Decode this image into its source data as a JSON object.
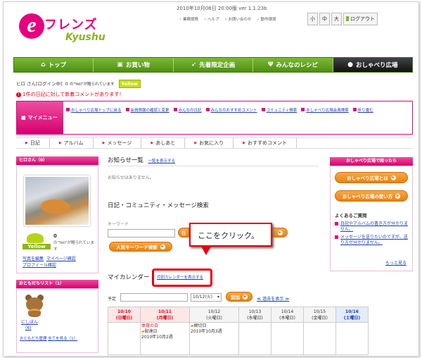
{
  "header": {
    "logo_text_jp": "フレンズ",
    "logo_text_en": "Kyushu",
    "version": "2010年10月08日 20:00版 ver 1.1.23b",
    "links": [
      "業務提携",
      "ヘルプ",
      "お問い合わせ",
      "動作環境"
    ],
    "size_buttons": [
      "小",
      "中",
      "大"
    ],
    "logout": "ログアウト"
  },
  "nav": {
    "items": [
      {
        "label": "トップ",
        "icon": "home-icon"
      },
      {
        "label": "お買い物",
        "icon": "shopping-icon"
      },
      {
        "label": "先着限定企画",
        "icon": "runner-icon"
      },
      {
        "label": "みんなのレシピ",
        "icon": "cutlery-icon"
      },
      {
        "label": "おしゃべり広場",
        "icon": "chat-icon"
      }
    ]
  },
  "user": {
    "name_line": "ヒロ さん[ログイン中]",
    "yell_count": "0",
    "yell_text": "の\"Yell\"が贈られています",
    "badge": "Yellow"
  },
  "notice": "1件の日記に対して新着コメントがあります！",
  "mymenu": {
    "label": "マイメニュー",
    "items": [
      "おしゃべり広場トップに戻る",
      "会員情報の確認と変更",
      "みんなの日記",
      "みんなのおすすめコメント",
      "コミュニティ検索",
      "おしゃべり広場会員検索",
      "折り畳む"
    ]
  },
  "subtabs": [
    "日記",
    "アルバム",
    "メッセージ",
    "あしあと",
    "お気に入り",
    "おすすめコメント"
  ],
  "left": {
    "profile_head": "ヒロさん（0）",
    "yell_num": "0",
    "yell_desc": "の\"Yell\"が贈られています",
    "badge": "Yellow",
    "links": [
      "写真を編集",
      "マイページ確認",
      "プロフィール確認"
    ],
    "friends_head": "おともだちリスト（1）",
    "friend_name": "にしぽん",
    "friend_count": "(6)",
    "friend_links": [
      "おともだち管理",
      "全てを見る（1）"
    ]
  },
  "center": {
    "notice_title": "お知らせ一覧",
    "notice_link": "一覧を表示する",
    "notice_empty": "お知らせはありません。",
    "search_title": "日記・コミュニティ・メッセージ検索",
    "keyword_label": "キーワード",
    "popular_btn": "人気キーワード検索",
    "callout": "ここをクリック。",
    "calendar_title": "マイカレンダー",
    "calendar_link": "月別カレンダーを表示する",
    "plan_label": "予定",
    "date_select": "10/12(火)",
    "add_btn": "追加",
    "prev_link": "≪ 過去を表示 ≫",
    "days": [
      {
        "date": "10/10",
        "dow": "(日曜日)",
        "color": "#e60012"
      },
      {
        "date": "10/11",
        "dow": "(月曜日)",
        "color": "#e60012"
      },
      {
        "date": "10/12",
        "dow": "(火曜日)",
        "color": "#333333"
      },
      {
        "date": "10/13",
        "dow": "(水曜日)",
        "color": "#333333"
      },
      {
        "date": "10/14",
        "dow": "(木曜日)",
        "color": "#333333"
      },
      {
        "date": "10/15",
        "dow": "(金曜日)",
        "color": "#333333"
      },
      {
        "date": "10/16",
        "dow": "(土曜日)",
        "color": "#1a3fb3"
      }
    ],
    "event_mon_1": "体育の日",
    "event_mon_2": "配達日",
    "event_mon_3": "2010年10月2週",
    "event_tue_1": "締切日",
    "event_tue_2": "2010年10月3週"
  },
  "right": {
    "head": "おしゃべり広場で困ったら",
    "btn1": "おしゃべり広場とは",
    "btn2": "おしゃべり広場の使い方",
    "faq_title": "よくあるご質問",
    "faq": [
      "日記やアルバムの書き方が分かりません。",
      "メッセージを送りたいのですが、送り方が分かりません。"
    ],
    "more": "もっと見る"
  },
  "colors": {
    "brand_pink": "#e3007f",
    "nav_green": "#5fa01f",
    "accent_orange": "#e8820d",
    "highlight_red": "#e60012"
  }
}
